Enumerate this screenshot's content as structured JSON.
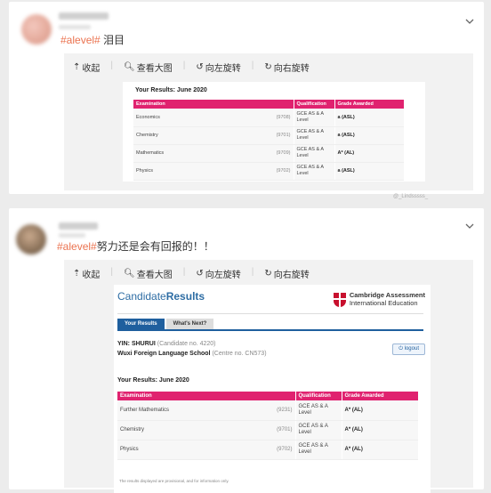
{
  "post1": {
    "hashtag": "#alevel#",
    "text": " 泪目",
    "toolbar": {
      "collapse": "收起",
      "view_large": "查看大图",
      "rotate_left": "向左旋转",
      "rotate_right": "向右旋转"
    },
    "results": {
      "title": "Your Results: June 2020",
      "headers": [
        "Examination",
        "Qualification",
        "Grade Awarded"
      ],
      "rows": [
        {
          "exam": "Economics",
          "code": "(9708)",
          "qual_1": "GCE AS & A",
          "qual_2": "Level",
          "grade": "a (ASL)"
        },
        {
          "exam": "Chemistry",
          "code": "(9701)",
          "qual_1": "GCE AS & A",
          "qual_2": "Level",
          "grade": "a (ASL)"
        },
        {
          "exam": "Mathematics",
          "code": "(9709)",
          "qual_1": "GCE AS & A",
          "qual_2": "Level",
          "grade": "A* (AL)"
        },
        {
          "exam": "Physics",
          "code": "(9702)",
          "qual_1": "GCE AS & A",
          "qual_2": "Level",
          "grade": "a (ASL)"
        }
      ],
      "watermark": "@_Lindsssss_"
    }
  },
  "post2": {
    "hashtag": "#alevel#",
    "text": "努力还是会有回报的！！",
    "toolbar": {
      "collapse": "收起",
      "view_large": "查看大图",
      "rotate_left": "向左旋转",
      "rotate_right": "向右旋转"
    },
    "results": {
      "logo_a": "Candidate",
      "logo_b": "Results",
      "org_line1": "Cambridge Assessment",
      "org_line2": "International Education",
      "tab_results": "Your Results",
      "tab_next": "What's Next?",
      "name": "YIN: SHURUI",
      "candidate_no": "(Candidate no. 4220)",
      "school": "Wuxi Foreign Language School",
      "centre_no": "(Centre no. CN573)",
      "logout": "logout",
      "title": "Your Results: June 2020",
      "headers": [
        "Examination",
        "Qualification",
        "Grade Awarded"
      ],
      "rows": [
        {
          "exam": "Further Mathematics",
          "code": "(9231)",
          "qual_1": "GCE AS & A",
          "qual_2": "Level",
          "grade": "A* (AL)"
        },
        {
          "exam": "Chemistry",
          "code": "(9701)",
          "qual_1": "GCE AS & A",
          "qual_2": "Level",
          "grade": "A* (AL)"
        },
        {
          "exam": "Physics",
          "code": "(9702)",
          "qual_1": "GCE AS & A",
          "qual_2": "Level",
          "grade": "A* (AL)"
        }
      ],
      "disclaimer": "The results displayed are provisional, and for information only."
    }
  }
}
